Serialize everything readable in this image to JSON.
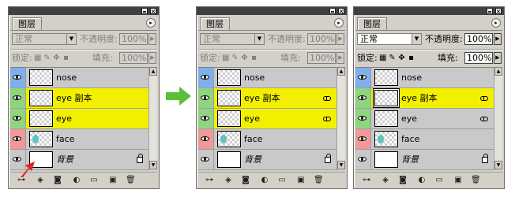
{
  "colors": {
    "highlight": "#f2f000",
    "blue_tag": "#7fb0ec",
    "green_tag": "#8fd47e",
    "red_tag": "#f19898",
    "accent_arrow": "#5bbf3a",
    "red_indicator": "#e0231e"
  },
  "panels": [
    {
      "title": "图层",
      "blend_mode": "正常",
      "opacity_label": "不透明度:",
      "opacity_value": "100%",
      "lock_label": "锁定:",
      "fill_label": "填充:",
      "fill_value": "100%",
      "enabled": false,
      "layers": [
        {
          "name": "nose",
          "tag": "blue",
          "highlight": false,
          "linked": false,
          "locked": false
        },
        {
          "name": "eye 副本",
          "tag": "green",
          "highlight": true,
          "linked": false,
          "locked": false
        },
        {
          "name": "eye",
          "tag": "green",
          "highlight": true,
          "linked": false,
          "locked": false
        },
        {
          "name": "face",
          "tag": "red",
          "highlight": false,
          "linked": false,
          "locked": false,
          "has_content": true
        },
        {
          "name": "背景",
          "tag": "none",
          "highlight": false,
          "linked": false,
          "locked": true,
          "italic": true
        }
      ]
    },
    {
      "title": "图层",
      "blend_mode": "正常",
      "opacity_label": "不透明度:",
      "opacity_value": "100%",
      "lock_label": "锁定:",
      "fill_label": "填充:",
      "fill_value": "100%",
      "enabled": false,
      "layers": [
        {
          "name": "nose",
          "tag": "blue",
          "highlight": false,
          "linked": false,
          "locked": false
        },
        {
          "name": "eye 副本",
          "tag": "green",
          "highlight": true,
          "linked": true,
          "locked": false
        },
        {
          "name": "eye",
          "tag": "green",
          "highlight": true,
          "linked": true,
          "locked": false
        },
        {
          "name": "face",
          "tag": "red",
          "highlight": false,
          "linked": false,
          "locked": false,
          "has_content": true
        },
        {
          "name": "背景",
          "tag": "none",
          "highlight": false,
          "linked": false,
          "locked": true,
          "italic": true
        }
      ]
    },
    {
      "title": "图层",
      "blend_mode": "正常",
      "opacity_label": "不透明度:",
      "opacity_value": "100%",
      "lock_label": "锁定:",
      "fill_label": "填充:",
      "fill_value": "100%",
      "enabled": true,
      "layers": [
        {
          "name": "nose",
          "tag": "blue",
          "highlight": false,
          "linked": false,
          "locked": false
        },
        {
          "name": "eye 副本",
          "tag": "green",
          "highlight": true,
          "linked": true,
          "locked": false,
          "active": true
        },
        {
          "name": "eye",
          "tag": "green",
          "highlight": false,
          "linked": true,
          "locked": false
        },
        {
          "name": "face",
          "tag": "red",
          "highlight": false,
          "linked": false,
          "locked": false,
          "has_content": true
        },
        {
          "name": "背景",
          "tag": "none",
          "highlight": false,
          "linked": false,
          "locked": true,
          "italic": true
        }
      ]
    }
  ]
}
